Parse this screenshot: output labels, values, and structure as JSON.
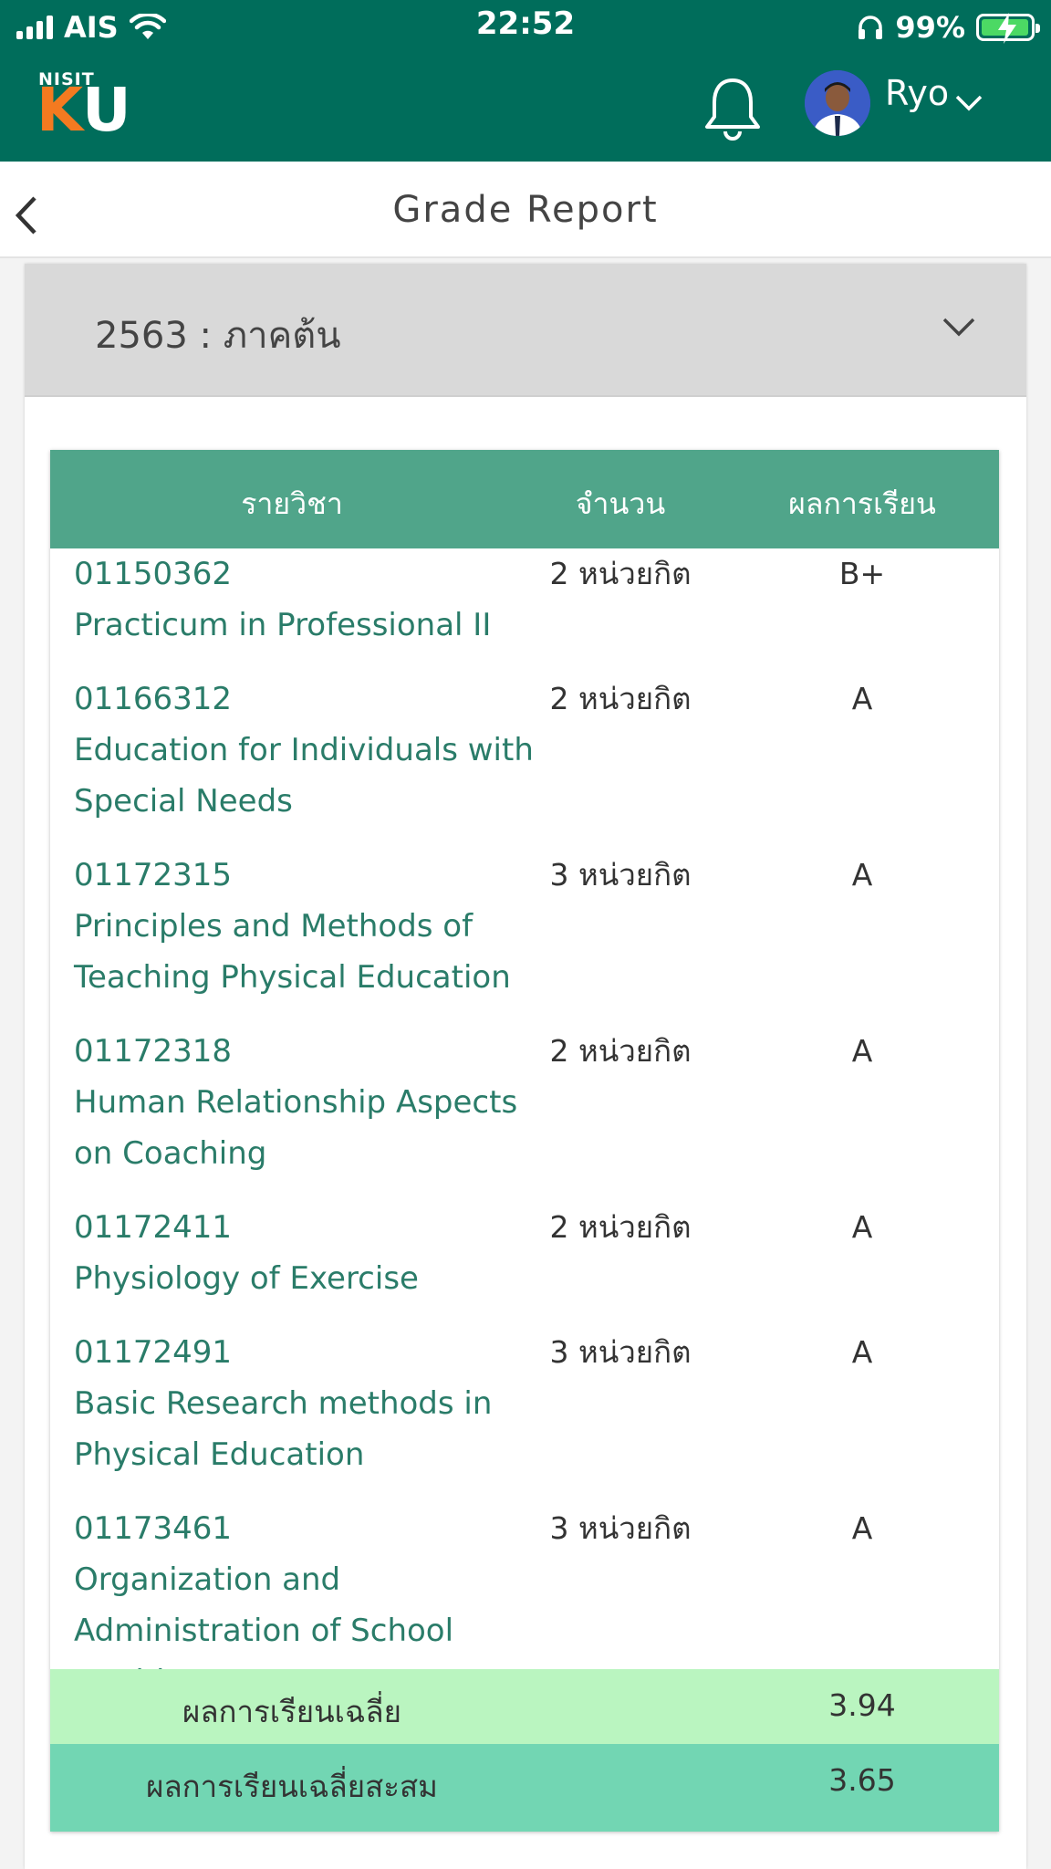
{
  "status_bar": {
    "carrier": "AIS",
    "time": "22:52",
    "battery": "99%"
  },
  "header": {
    "logo_small": "NISIT",
    "logo_k": "K",
    "logo_u": "U",
    "user_name": "Ryo"
  },
  "page": {
    "title": "Grade Report"
  },
  "term": {
    "label": "2563 : ภาคต้น"
  },
  "table": {
    "headers": {
      "subject": "รายวิชา",
      "credits": "จำนวน",
      "grade": "ผลการเรียน"
    },
    "rows": [
      {
        "code": "01150362",
        "name": "Practicum in Professional II",
        "credits": "2 หน่วยกิต",
        "grade": "B+"
      },
      {
        "code": "01166312",
        "name": "Education for Individuals with Special Needs",
        "credits": "2 หน่วยกิต",
        "grade": "A"
      },
      {
        "code": "01172315",
        "name": "Principles and Methods of Teaching Physical Education",
        "credits": "3 หน่วยกิต",
        "grade": "A"
      },
      {
        "code": "01172318",
        "name": "Human Relationship Aspects on Coaching",
        "credits": "2 หน่วยกิต",
        "grade": "A"
      },
      {
        "code": "01172411",
        "name": "Physiology of Exercise",
        "credits": "2 หน่วยกิต",
        "grade": "A"
      },
      {
        "code": "01172491",
        "name": "Basic Research methods in Physical Education",
        "credits": "3 หน่วยกิต",
        "grade": "A"
      },
      {
        "code": "01173461",
        "name": "Organization and Administration of School Health Prog",
        "credits": "3 หน่วยกิต",
        "grade": "A"
      }
    ],
    "gpa_label": "ผลการเรียนเฉลี่ย",
    "gpa_value": "3.94",
    "gpax_label": "ผลการเรียนเฉลี่ยสะสม",
    "gpax_value": "3.65"
  },
  "colors": {
    "header_bg": "#006d5b",
    "table_header": "#50a58a",
    "course_text": "#2a7c69",
    "gpa_row": "#baf5c0",
    "gpax_row": "#72d6b3",
    "logo_k": "#f47a20"
  }
}
